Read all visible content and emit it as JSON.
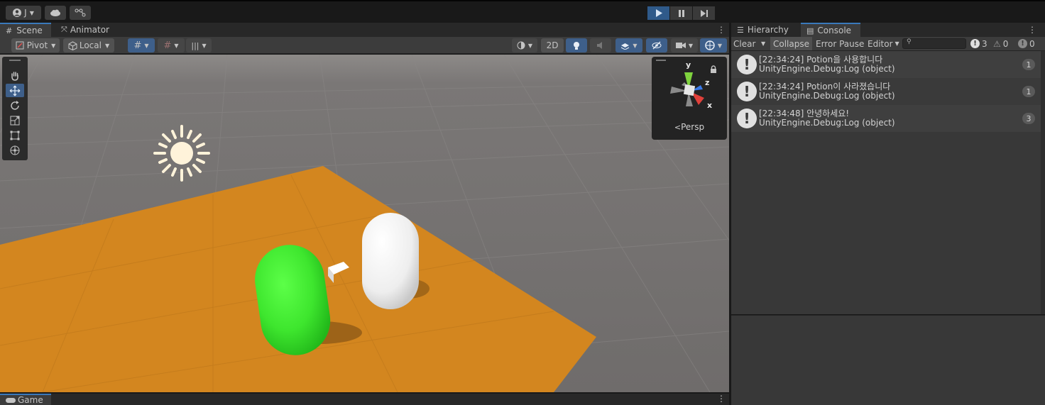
{
  "topbar": {
    "account_label": "J",
    "play_icon": "play-icon",
    "pause_icon": "pause-icon",
    "step_icon": "step-icon"
  },
  "scene": {
    "tabs": [
      {
        "label": "Scene",
        "icon": "grid-icon"
      },
      {
        "label": "Animator",
        "icon": "animator-icon"
      }
    ],
    "toolbar": {
      "pivot_label": "Pivot",
      "local_label": "Local",
      "mode_2d_label": "2D"
    },
    "gizmo": {
      "axis_y": "y",
      "axis_z": "z",
      "axis_x": "x",
      "projection_label": "Persp"
    },
    "colors": {
      "plane": "#d3861f",
      "green_capsule": "#3ee62e",
      "white_capsule": "#f2f2f2",
      "accent": "#3a79bb"
    }
  },
  "game": {
    "tab_label": "Game"
  },
  "console": {
    "tabs": [
      {
        "label": "Hierarchy",
        "icon": "hierarchy-icon"
      },
      {
        "label": "Console",
        "icon": "console-icon"
      }
    ],
    "toolbar": {
      "clear_label": "Clear",
      "collapse_label": "Collapse",
      "error_pause_label": "Error Pause",
      "editor_label": "Editor",
      "search_placeholder": "",
      "info_count": "3",
      "warning_count": "0",
      "error_count": "0"
    },
    "logs": [
      {
        "line1": "[22:34:24] Potion을 사용합니다",
        "line2": "UnityEngine.Debug:Log (object)",
        "count": "1"
      },
      {
        "line1": "[22:34:24] Potion이 사라졌습니다",
        "line2": "UnityEngine.Debug:Log (object)",
        "count": "1"
      },
      {
        "line1": "[22:34:48] 안녕하세요!",
        "line2": "UnityEngine.Debug:Log (object)",
        "count": "3"
      }
    ]
  }
}
